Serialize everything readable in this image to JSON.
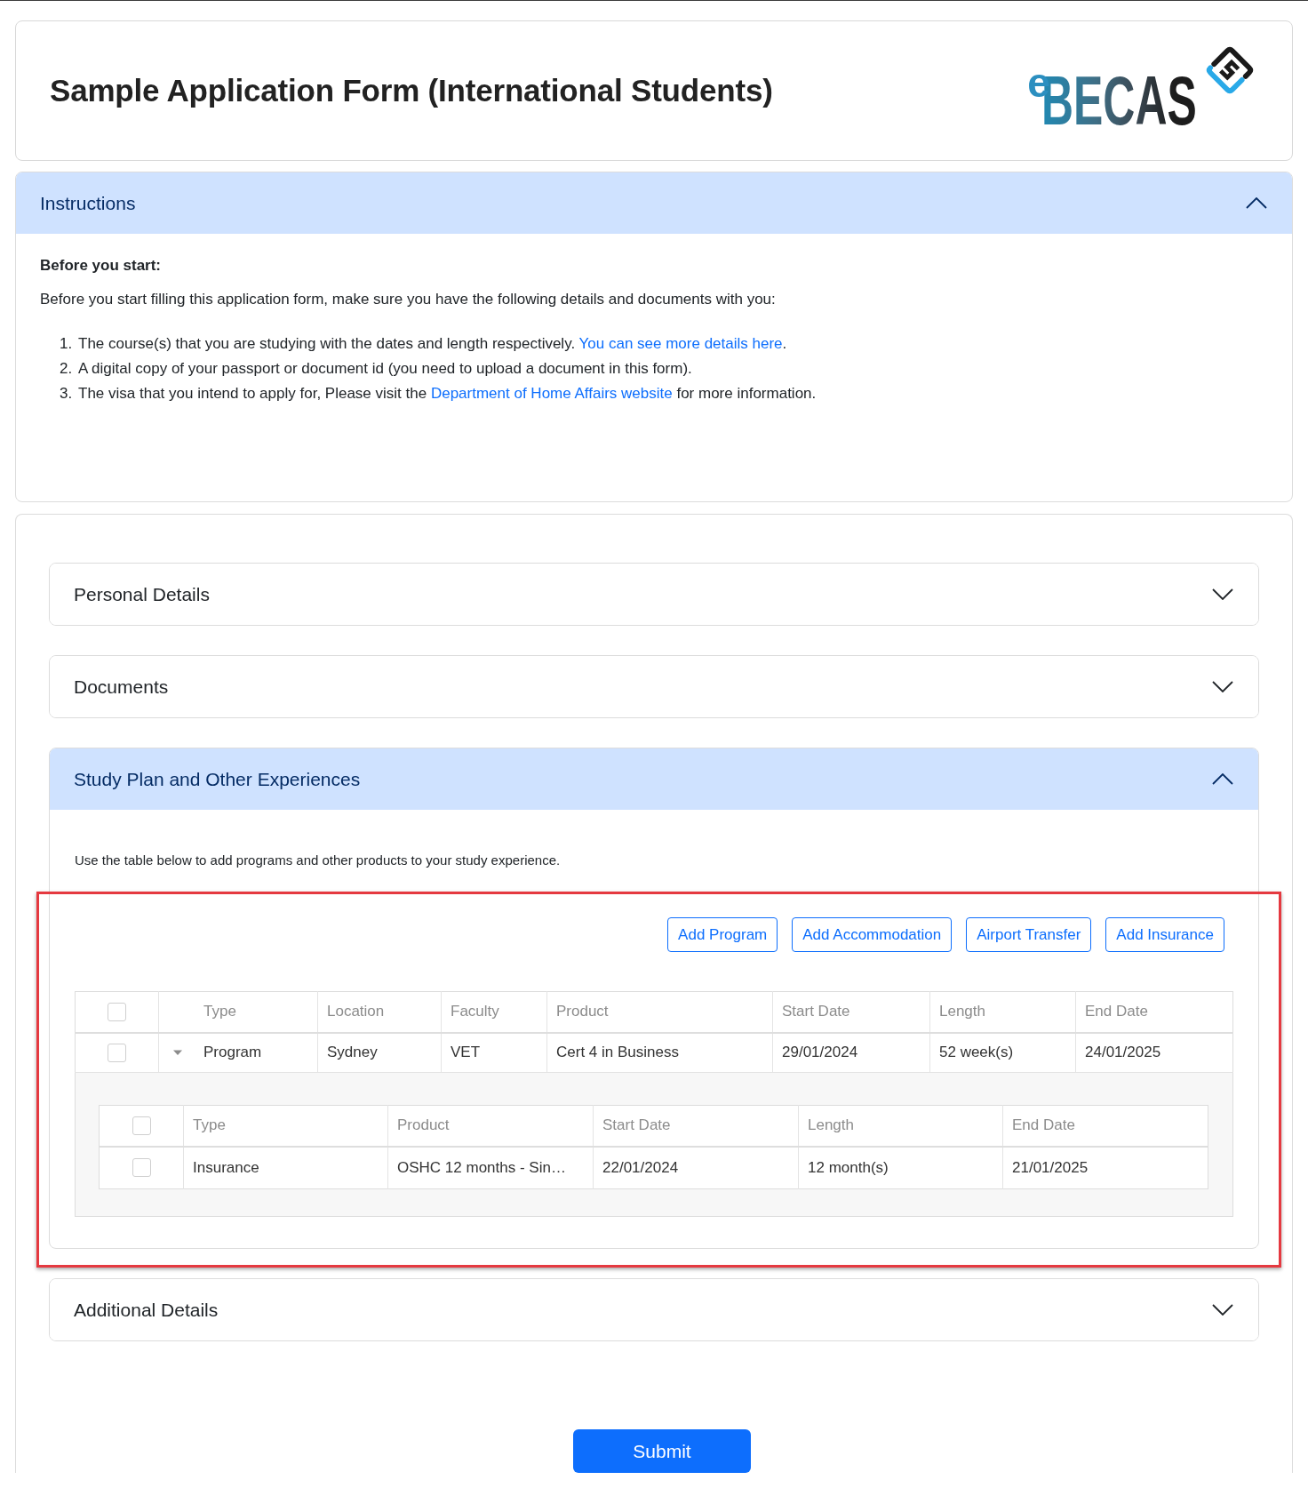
{
  "header": {
    "title": "Sample Application Form (International Students)",
    "logo": {
      "prefix": "e",
      "name": "BECAS"
    }
  },
  "instructions": {
    "title": "Instructions",
    "expanded": true,
    "heading": "Before you start:",
    "intro": "Before you start filling this application form, make sure you have the following details and documents with you:",
    "items": [
      {
        "number": "1.",
        "parts": [
          {
            "kind": "text",
            "text": "The course(s) that you are studying with the dates and length respectively. "
          },
          {
            "kind": "link",
            "text": "You can see more details here"
          },
          {
            "kind": "text",
            "text": "."
          }
        ]
      },
      {
        "number": "2.",
        "parts": [
          {
            "kind": "text",
            "text": "A digital copy of your passport or document id (you need to upload a document in this form)."
          }
        ]
      },
      {
        "number": "3.",
        "parts": [
          {
            "kind": "text",
            "text": "The visa that you intend to apply for, Please visit the "
          },
          {
            "kind": "link",
            "text": "Department of Home Affairs website"
          },
          {
            "kind": "text",
            "text": " for more information."
          }
        ]
      }
    ]
  },
  "sections": [
    {
      "title": "Personal Details",
      "expanded": false
    },
    {
      "title": "Documents",
      "expanded": false
    },
    {
      "title": "Study Plan and Other Experiences",
      "expanded": true,
      "description": "Use the table below to add programs and other products to your study experience.",
      "highlighted": true,
      "buttons": [
        "Add Program",
        "Add Accommodation",
        "Airport Transfer",
        "Add Insurance"
      ],
      "table": {
        "header_checked": false,
        "columns": [
          "Type",
          "Location",
          "Faculty",
          "Product",
          "Start Date",
          "Length",
          "End Date"
        ],
        "rows": [
          {
            "checked": false,
            "expanded": true,
            "cells": [
              "Program",
              "Sydney",
              "VET",
              "Cert 4 in Business",
              "29/01/2024",
              "52 week(s)",
              "24/01/2025"
            ],
            "detail": {
              "header_checked": false,
              "columns": [
                "Type",
                "Product",
                "Start Date",
                "Length",
                "End Date"
              ],
              "rows": [
                {
                  "checked": false,
                  "cells": [
                    "Insurance",
                    "OSHC 12 months - Sin…",
                    "22/01/2024",
                    "12 month(s)",
                    "21/01/2025"
                  ]
                }
              ]
            }
          }
        ]
      }
    },
    {
      "title": "Additional Details",
      "expanded": false
    }
  ],
  "submit": "Submit"
}
